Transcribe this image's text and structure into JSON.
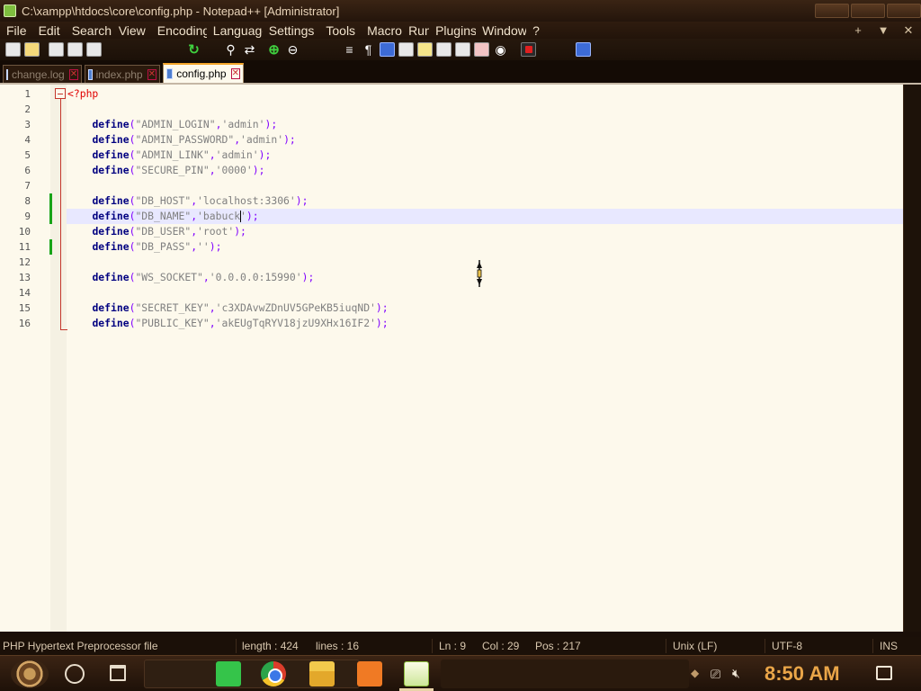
{
  "window": {
    "title": "C:\\xampp\\htdocs\\core\\config.php - Notepad++ [Administrator]",
    "controls": [
      "minimize",
      "maximize",
      "close"
    ]
  },
  "menu": {
    "items": [
      "File",
      "Edit",
      "Search",
      "View",
      "Encoding",
      "Language",
      "Settings",
      "Tools",
      "Macro",
      "Run",
      "Plugins",
      "Window",
      "?"
    ],
    "right_controls": [
      "+",
      "▼",
      "✕"
    ]
  },
  "toolbar": {
    "icons": [
      "new-file-icon",
      "open-file-icon",
      "save-icon",
      "save-all-icon",
      "print-icon",
      "redo-icon",
      "find-icon",
      "replace-icon",
      "zoom-in-icon",
      "zoom-out-icon",
      "sync-scroll-icon",
      "word-wrap-icon",
      "show-all-chars-icon",
      "indent-guide-icon",
      "lang-icon",
      "doc-map-icon",
      "function-list-icon",
      "folder-workspace-icon",
      "monitor-icon",
      "record-macro-icon",
      "run-macro-icon"
    ]
  },
  "tabs": [
    {
      "label": "change.log",
      "active": false
    },
    {
      "label": "index.php",
      "active": false
    },
    {
      "label": "config.php",
      "active": true
    }
  ],
  "editor": {
    "caret_line": 9,
    "lines": [
      {
        "num": "1",
        "tokens": [
          {
            "t": "<?php",
            "c": "php-open"
          }
        ]
      },
      {
        "num": "2",
        "tokens": []
      },
      {
        "num": "3",
        "tokens": [
          {
            "t": "    ",
            "c": ""
          },
          {
            "t": "define",
            "c": "kw"
          },
          {
            "t": "(",
            "c": "pun"
          },
          {
            "t": "\"ADMIN_LOGIN\"",
            "c": "str"
          },
          {
            "t": ",",
            "c": "pun"
          },
          {
            "t": "'admin'",
            "c": "str"
          },
          {
            "t": ");",
            "c": "pun"
          }
        ]
      },
      {
        "num": "4",
        "tokens": [
          {
            "t": "    ",
            "c": ""
          },
          {
            "t": "define",
            "c": "kw"
          },
          {
            "t": "(",
            "c": "pun"
          },
          {
            "t": "\"ADMIN_PASSWORD\"",
            "c": "str"
          },
          {
            "t": ",",
            "c": "pun"
          },
          {
            "t": "'admin'",
            "c": "str"
          },
          {
            "t": ");",
            "c": "pun"
          }
        ]
      },
      {
        "num": "5",
        "tokens": [
          {
            "t": "    ",
            "c": ""
          },
          {
            "t": "define",
            "c": "kw"
          },
          {
            "t": "(",
            "c": "pun"
          },
          {
            "t": "\"ADMIN_LINK\"",
            "c": "str"
          },
          {
            "t": ",",
            "c": "pun"
          },
          {
            "t": "'admin'",
            "c": "str"
          },
          {
            "t": ");",
            "c": "pun"
          }
        ]
      },
      {
        "num": "6",
        "tokens": [
          {
            "t": "    ",
            "c": ""
          },
          {
            "t": "define",
            "c": "kw"
          },
          {
            "t": "(",
            "c": "pun"
          },
          {
            "t": "\"SECURE_PIN\"",
            "c": "str"
          },
          {
            "t": ",",
            "c": "pun"
          },
          {
            "t": "'0000'",
            "c": "str"
          },
          {
            "t": ");",
            "c": "pun"
          }
        ]
      },
      {
        "num": "7",
        "tokens": []
      },
      {
        "num": "8",
        "tokens": [
          {
            "t": "    ",
            "c": ""
          },
          {
            "t": "define",
            "c": "kw"
          },
          {
            "t": "(",
            "c": "pun"
          },
          {
            "t": "\"DB_HOST\"",
            "c": "str"
          },
          {
            "t": ",",
            "c": "pun"
          },
          {
            "t": "'localhost:3306'",
            "c": "str"
          },
          {
            "t": ");",
            "c": "pun"
          }
        ]
      },
      {
        "num": "9",
        "tokens": [
          {
            "t": "    ",
            "c": ""
          },
          {
            "t": "define",
            "c": "kw"
          },
          {
            "t": "(",
            "c": "pun"
          },
          {
            "t": "\"DB_NAME\"",
            "c": "str"
          },
          {
            "t": ",",
            "c": "pun"
          },
          {
            "t": "'babuck",
            "c": "str"
          },
          {
            "t": "",
            "c": "caret"
          },
          {
            "t": "'",
            "c": "str"
          },
          {
            "t": ");",
            "c": "pun"
          }
        ]
      },
      {
        "num": "10",
        "tokens": [
          {
            "t": "    ",
            "c": ""
          },
          {
            "t": "define",
            "c": "kw"
          },
          {
            "t": "(",
            "c": "pun"
          },
          {
            "t": "\"DB_USER\"",
            "c": "str"
          },
          {
            "t": ",",
            "c": "pun"
          },
          {
            "t": "'root'",
            "c": "str"
          },
          {
            "t": ");",
            "c": "pun"
          }
        ]
      },
      {
        "num": "11",
        "tokens": [
          {
            "t": "    ",
            "c": ""
          },
          {
            "t": "define",
            "c": "kw"
          },
          {
            "t": "(",
            "c": "pun"
          },
          {
            "t": "\"DB_PASS\"",
            "c": "str"
          },
          {
            "t": ",",
            "c": "pun"
          },
          {
            "t": "''",
            "c": "str"
          },
          {
            "t": ");",
            "c": "pun"
          }
        ]
      },
      {
        "num": "12",
        "tokens": []
      },
      {
        "num": "13",
        "tokens": [
          {
            "t": "    ",
            "c": ""
          },
          {
            "t": "define",
            "c": "kw"
          },
          {
            "t": "(",
            "c": "pun"
          },
          {
            "t": "\"WS_SOCKET\"",
            "c": "str"
          },
          {
            "t": ",",
            "c": "pun"
          },
          {
            "t": "'0.0.0.0:15990'",
            "c": "str"
          },
          {
            "t": ");",
            "c": "pun"
          }
        ]
      },
      {
        "num": "14",
        "tokens": []
      },
      {
        "num": "15",
        "tokens": [
          {
            "t": "    ",
            "c": ""
          },
          {
            "t": "define",
            "c": "kw"
          },
          {
            "t": "(",
            "c": "pun"
          },
          {
            "t": "\"SECRET_KEY\"",
            "c": "str"
          },
          {
            "t": ",",
            "c": "pun"
          },
          {
            "t": "'c3XDAvwZDnUV5GPeKB5iuqND'",
            "c": "str"
          },
          {
            "t": ");",
            "c": "pun"
          }
        ]
      },
      {
        "num": "16",
        "tokens": [
          {
            "t": "    ",
            "c": ""
          },
          {
            "t": "define",
            "c": "kw"
          },
          {
            "t": "(",
            "c": "pun"
          },
          {
            "t": "\"PUBLIC_KEY\"",
            "c": "str"
          },
          {
            "t": ",",
            "c": "pun"
          },
          {
            "t": "'akEUgTqRYV18jzU9XHx16IF2'",
            "c": "str"
          },
          {
            "t": ");",
            "c": "pun"
          }
        ]
      }
    ],
    "changed_lines": [
      "8",
      "9",
      "11"
    ]
  },
  "statusbar": {
    "file_type": "PHP Hypertext Preprocessor file",
    "length": "length : 424",
    "lines": "lines : 16",
    "ln": "Ln : 9",
    "col": "Col : 29",
    "pos": "Pos : 217",
    "eol": "Unix (LF)",
    "encoding": "UTF-8",
    "mode": "INS"
  },
  "taskbar": {
    "apps": [
      "sublime-text-icon",
      "chrome-icon",
      "file-explorer-icon",
      "xampp-icon",
      "notepadpp-icon"
    ],
    "clock": "8:50 AM"
  },
  "colors": {
    "keyword": "#000080",
    "string": "#808080",
    "punctuation": "#8000ff",
    "php_tag": "#e00000",
    "caret_line": "#e8e8ff",
    "change_marker": "#18a418",
    "clock": "#e9a548"
  }
}
